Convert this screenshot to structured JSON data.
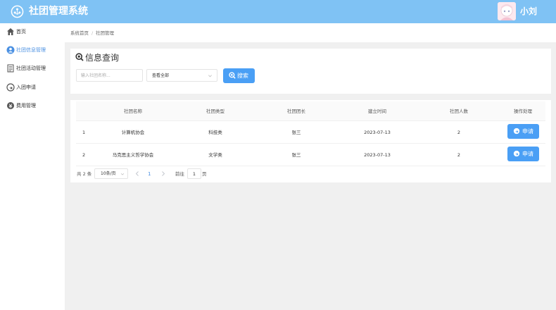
{
  "app": {
    "title": "社团管理系统",
    "user_name": "小刘"
  },
  "sidebar": {
    "items": [
      {
        "label": "首页",
        "icon": "home-icon"
      },
      {
        "label": "社团信息管理",
        "icon": "user-icon",
        "active": true
      },
      {
        "label": "社团活动管理",
        "icon": "document-icon"
      },
      {
        "label": "入团申请",
        "icon": "share-icon"
      },
      {
        "label": "费用管理",
        "icon": "money-icon"
      }
    ]
  },
  "breadcrumb": {
    "home": "系统首页",
    "separator": "/",
    "current": "社团管理"
  },
  "search": {
    "title": "信息查询",
    "name_placeholder": "输入社团名称...",
    "type_value": "查看全部",
    "button_label": "搜索"
  },
  "table": {
    "columns": [
      "社团名称",
      "社团类型",
      "社团团长",
      "建立时间",
      "社团人数",
      "操作处理"
    ],
    "rows": [
      {
        "index": "1",
        "name": "计算机协会",
        "type": "科技类",
        "leader": "张三",
        "date": "2023-07-13",
        "members": "2",
        "action": "申请"
      },
      {
        "index": "2",
        "name": "马克思主义哲学协会",
        "type": "文学类",
        "leader": "张三",
        "date": "2023-07-13",
        "members": "2",
        "action": "申请"
      }
    ]
  },
  "pagination": {
    "total_text": "共 2 条",
    "page_size": "10条/页",
    "current_page": "1",
    "goto_label": "前往",
    "goto_value": "1",
    "page_suffix": "页"
  },
  "colors": {
    "header": "#7fc2f4",
    "primary": "#4a9ff5",
    "active_text": "#4a90e2"
  }
}
